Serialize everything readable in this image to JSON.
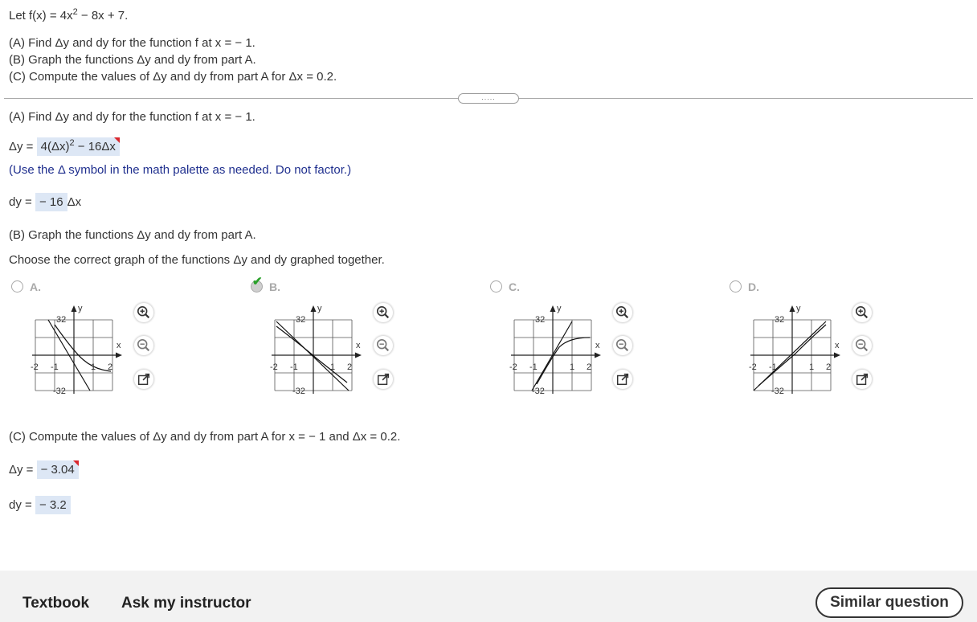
{
  "problem": {
    "intro_prefix": "Let f(x) = 4x",
    "intro_exp": "2",
    "intro_suffix": " − 8x + 7.",
    "task_a": "(A)  Find Δy and dy for the function f at x = − 1.",
    "task_b": "(B)  Graph the functions Δy and dy from part A.",
    "task_c": "(C)  Compute the values of Δy and dy from part A for Δx = 0.2."
  },
  "splitter": {
    "label": "....."
  },
  "part_a": {
    "heading": "(A)  Find Δy and dy for the function f at x = − 1.",
    "dy_big_label": "Δy =",
    "dy_big_answer_prefix": "4(Δx)",
    "dy_big_answer_exp": "2",
    "dy_big_answer_suffix": " − 16Δx",
    "hint": "(Use the Δ symbol in the math palette as needed. Do not factor.)",
    "dy_label": "dy =",
    "dy_answer": "− 16",
    "dy_unit": "Δx"
  },
  "part_b": {
    "heading": "(B)  Graph the functions Δy and dy from part A.",
    "instruction": "Choose the correct graph of the functions Δy and dy graphed together.",
    "selected": "B",
    "options": [
      {
        "letter": "A."
      },
      {
        "letter": "B."
      },
      {
        "letter": "C."
      },
      {
        "letter": "D."
      }
    ],
    "graph_labels": {
      "y": "y",
      "x": "x",
      "ytop": "32",
      "ybot": "-32",
      "xm2": "-2",
      "xm1": "-1",
      "x1": "1",
      "x2": "2"
    }
  },
  "part_c": {
    "heading": "(C)  Compute the values of Δy and dy from part A for x = − 1 and Δx = 0.2.",
    "dy_big_label": "Δy =",
    "dy_big_answer": "− 3.04",
    "dy_label": "dy =",
    "dy_answer": "− 3.2"
  },
  "footer": {
    "textbook": "Textbook",
    "ask": "Ask my instructor",
    "similar": "Similar question"
  },
  "icons": [
    "zoom-in-icon",
    "zoom-out-icon",
    "new-window-icon",
    "checkmark-icon"
  ],
  "colors": {
    "answer_bg": "#dde7f5",
    "hint": "#1f2f8e",
    "check": "#2aa12a",
    "flag": "#d9272e"
  }
}
